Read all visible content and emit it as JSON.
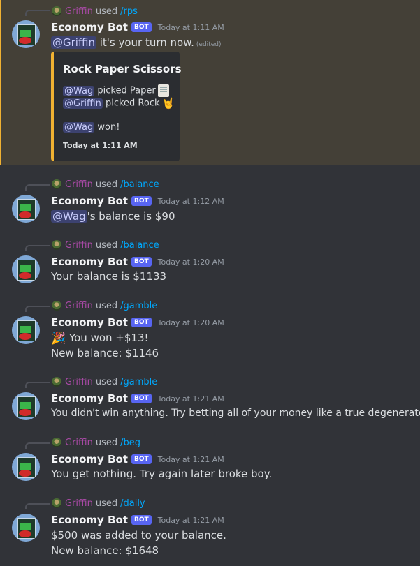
{
  "messages": [
    {
      "reply": {
        "name": "Griffin",
        "used": "used",
        "command": "/rps"
      },
      "author": "Economy Bot",
      "tag": "BOT",
      "time": "Today at 1:11 AM",
      "mention": "@Griffin",
      "text": " it's your turn now.",
      "edited": "(edited)",
      "embed": {
        "title": "Rock Paper Scissors",
        "line1_mention": "@Wag",
        "line1_text": " picked Paper",
        "line2_mention": "@Griffin",
        "line2_text": " picked Rock",
        "line3_mention": "@Wag",
        "line3_text": " won!",
        "footer": "Today at 1:11 AM"
      }
    },
    {
      "reply": {
        "name": "Griffin",
        "used": "used",
        "command": "/balance"
      },
      "author": "Economy Bot",
      "tag": "BOT",
      "time": "Today at 1:12 AM",
      "mention": "@Wag",
      "text": "'s balance is $90"
    },
    {
      "reply": {
        "name": "Griffin",
        "used": "used",
        "command": "/balance"
      },
      "author": "Economy Bot",
      "tag": "BOT",
      "time": "Today at 1:20 AM",
      "text": "Your balance is $1133"
    },
    {
      "reply": {
        "name": "Griffin",
        "used": "used",
        "command": "/gamble"
      },
      "author": "Economy Bot",
      "tag": "BOT",
      "time": "Today at 1:20 AM",
      "emoji": "party-popper-icon",
      "text": " You won +$13!",
      "text2": "New balance: $1146"
    },
    {
      "reply": {
        "name": "Griffin",
        "used": "used",
        "command": "/gamble"
      },
      "author": "Economy Bot",
      "tag": "BOT",
      "time": "Today at 1:21 AM",
      "text": "You didn't win anything. Try betting all of your money like a true degenerate."
    },
    {
      "reply": {
        "name": "Griffin",
        "used": "used",
        "command": "/beg"
      },
      "author": "Economy Bot",
      "tag": "BOT",
      "time": "Today at 1:21 AM",
      "text": "You get nothing. Try again later broke boy."
    },
    {
      "reply": {
        "name": "Griffin",
        "used": "used",
        "command": "/daily"
      },
      "author": "Economy Bot",
      "tag": "BOT",
      "time": "Today at 1:21 AM",
      "text": "$500 was added to your balance.",
      "text2": "New balance: $1648"
    }
  ],
  "colors": {
    "background": "#313338",
    "highlight": "#444037",
    "highlight_bar": "#f0b132",
    "mention_bg": "#3c4270",
    "reply_name": "#a84aa5",
    "command": "#00a8fc",
    "bot_tag": "#5865f2"
  }
}
